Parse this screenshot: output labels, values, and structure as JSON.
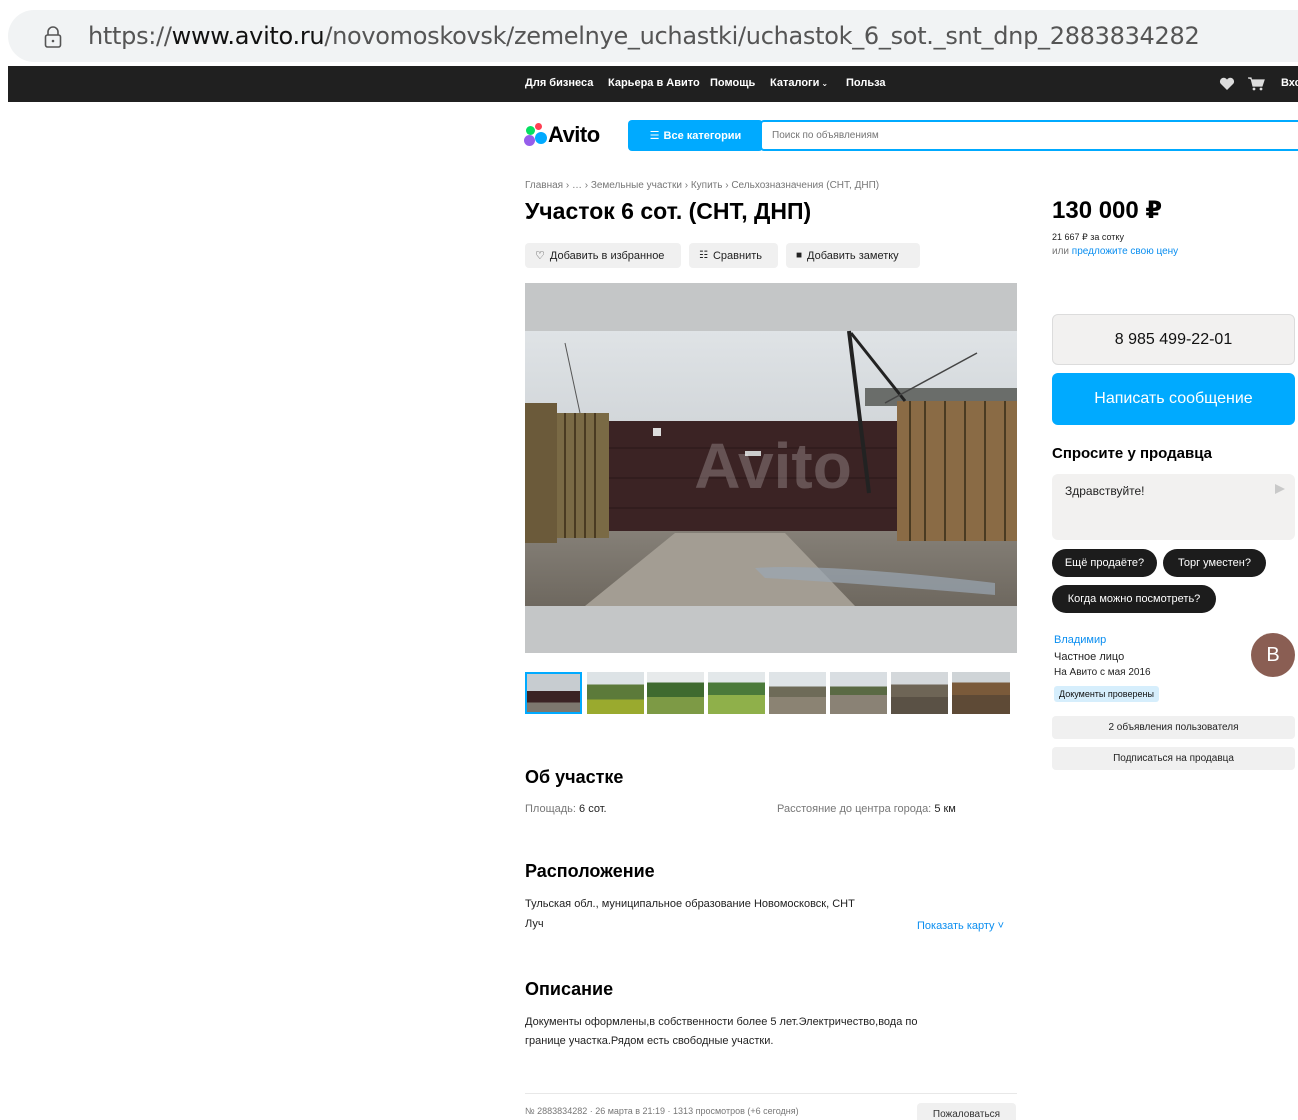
{
  "browser": {
    "url_prefix": "https://",
    "url_domain": "www.avito.ru",
    "url_path": "/novomoskovsk/zemelnye_uchastki/uchastok_6_sot._snt_dnp_2883834282"
  },
  "topnav": {
    "items": [
      "Для бизнеса",
      "Карьера в Авито",
      "Помощь",
      "Каталоги",
      "Польза"
    ],
    "login": "Вхо"
  },
  "header": {
    "logo": "Avito",
    "all_categories": "Все категории",
    "search_placeholder": "Поиск по объявлениям"
  },
  "breadcrumb": "Главная › … › Земельные участки › Купить › Сельхозназначения (СНТ, ДНП)",
  "listing": {
    "title": "Участок 6 сот. (СНТ, ДНП)",
    "actions": {
      "favorite": "Добавить в избранное",
      "compare": "Сравнить",
      "note": "Добавить заметку"
    },
    "watermark": "Avito"
  },
  "about": {
    "heading": "Об участке",
    "area_label": "Площадь:",
    "area_value": "6 сот.",
    "distance_label": "Расстояние до центра города:",
    "distance_value": "5 км"
  },
  "location": {
    "heading": "Расположение",
    "address_line1": "Тульская обл., муниципальное образование Новомосковск, СНТ",
    "address_line2": "Луч",
    "show_map": "Показать карту ˅"
  },
  "description": {
    "heading": "Описание",
    "line1": "Документы оформлены,в собственности более 5 лет.Электричество,вода по",
    "line2": "границе участка.Рядом есть свободные участки."
  },
  "footer": {
    "meta": "№ 2883834282 · 26 марта в 21:19 · 1313 просмотров (+6 сегодня)",
    "complain": "Пожаловаться"
  },
  "sidebar": {
    "price": "130 000 ₽",
    "price_per": "21 667 ₽ за сотку",
    "price_offer_prefix": "или ",
    "price_offer_link": "предложите свою цену",
    "phone": "8 985 499-22-01",
    "message_button": "Написать сообщение",
    "ask_heading": "Спросите у продавца",
    "ask_placeholder": "Здравствуйте!",
    "chips": [
      "Ещё продаёте?",
      "Торг уместен?",
      "Когда можно посмотреть?"
    ],
    "seller_name": "Владимир",
    "seller_type": "Частное лицо",
    "seller_since": "На Авито с мая 2016",
    "seller_badge": "Документы проверены",
    "avatar_letter": "В",
    "ads_button": "2 объявления пользователя",
    "subscribe_button": "Подписаться на продавца"
  },
  "colors": {
    "accent": "#00aaff",
    "topnav_bg": "#202020",
    "link": "#0a8ef0",
    "avatar": "#8a5e53"
  }
}
